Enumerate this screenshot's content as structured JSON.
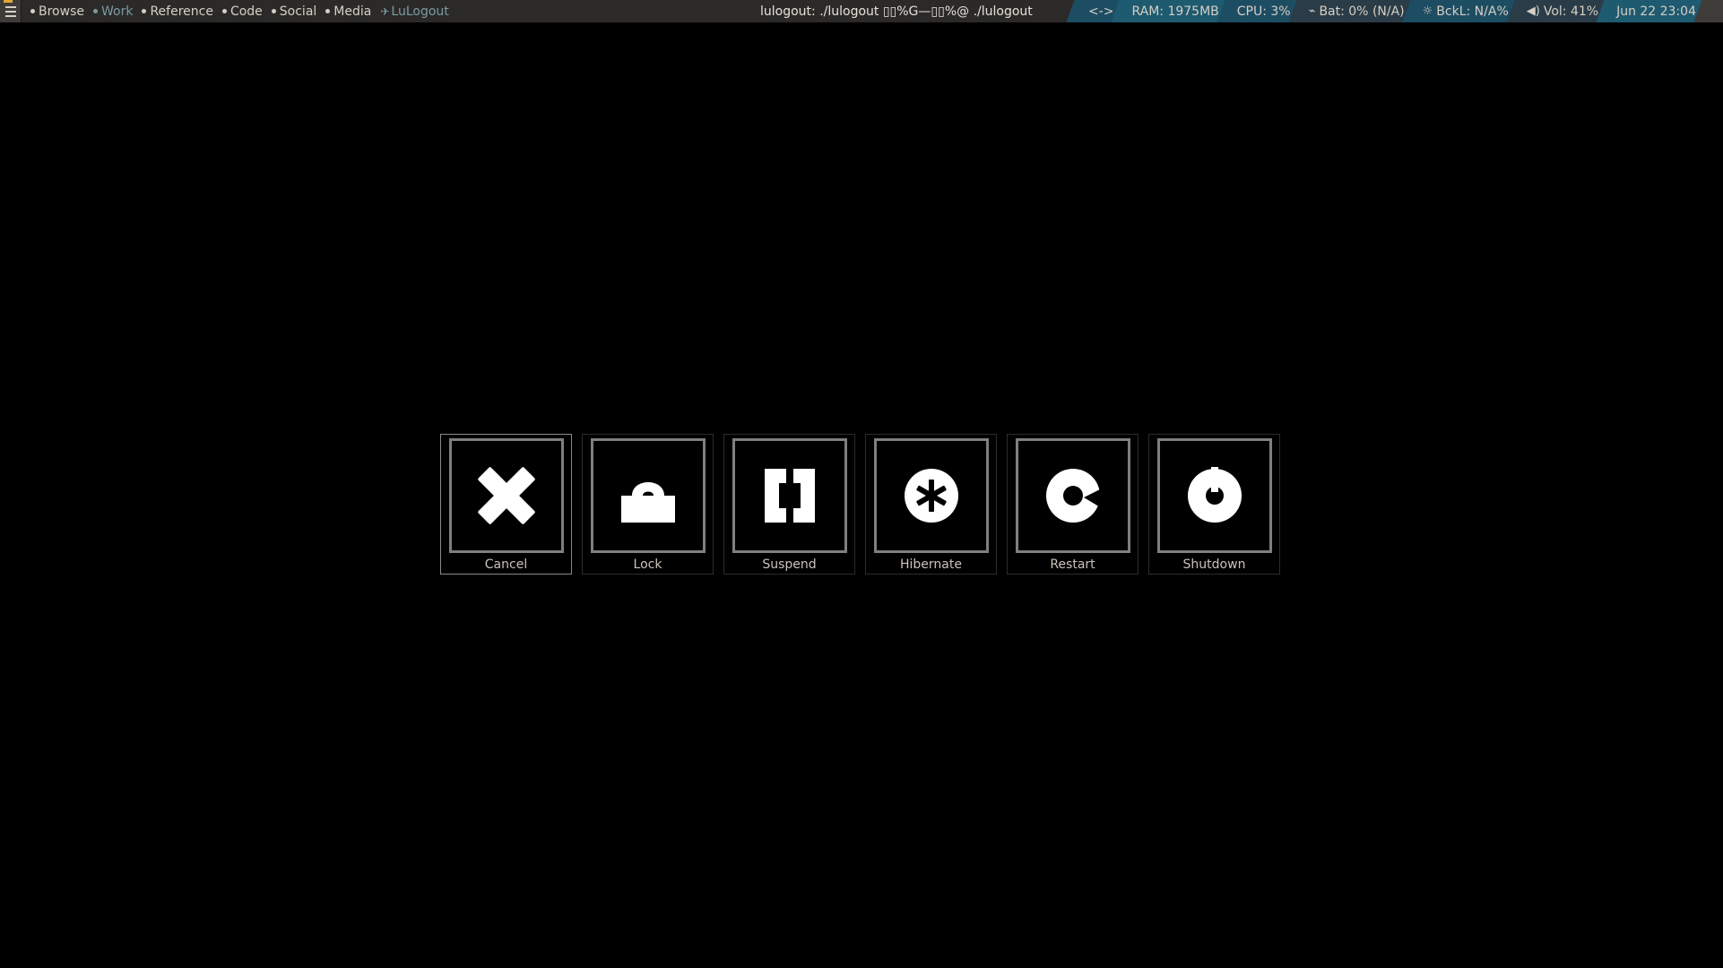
{
  "panel": {
    "tags": [
      {
        "label": "Browse",
        "active": true
      },
      {
        "label": "Work",
        "active": false
      },
      {
        "label": "Reference",
        "active": true
      },
      {
        "label": "Code",
        "active": true
      },
      {
        "label": "Social",
        "active": true
      },
      {
        "label": "Media",
        "active": true
      }
    ],
    "launcher": {
      "label": "LuLogout"
    },
    "window_title": "lulogout: ./lulogout ▯▯%G—▯▯%@ ./lulogout",
    "status": {
      "net_icon": "<->",
      "ram": "RAM: 1975MB",
      "cpu": "CPU: 3%",
      "battery": "Bat: 0% (N/A)",
      "backlight": "BckL: N/A%",
      "volume": "Vol: 41%",
      "datetime": "Jun 22 23:04"
    }
  },
  "logout": {
    "options": [
      {
        "label": "Cancel",
        "icon": "close-icon",
        "selected": true
      },
      {
        "label": "Lock",
        "icon": "lock-icon",
        "selected": false
      },
      {
        "label": "Suspend",
        "icon": "suspend-icon",
        "selected": false
      },
      {
        "label": "Hibernate",
        "icon": "hibernate-icon",
        "selected": false
      },
      {
        "label": "Restart",
        "icon": "restart-icon",
        "selected": false
      },
      {
        "label": "Shutdown",
        "icon": "power-icon",
        "selected": false
      }
    ]
  },
  "colors": {
    "background": "#000000",
    "panel": "#2b2a29",
    "panel_text": "#d6cfc4",
    "status_accent": "#1d4d63",
    "frame": "#7f7f7f",
    "icon": "#ffffff"
  }
}
